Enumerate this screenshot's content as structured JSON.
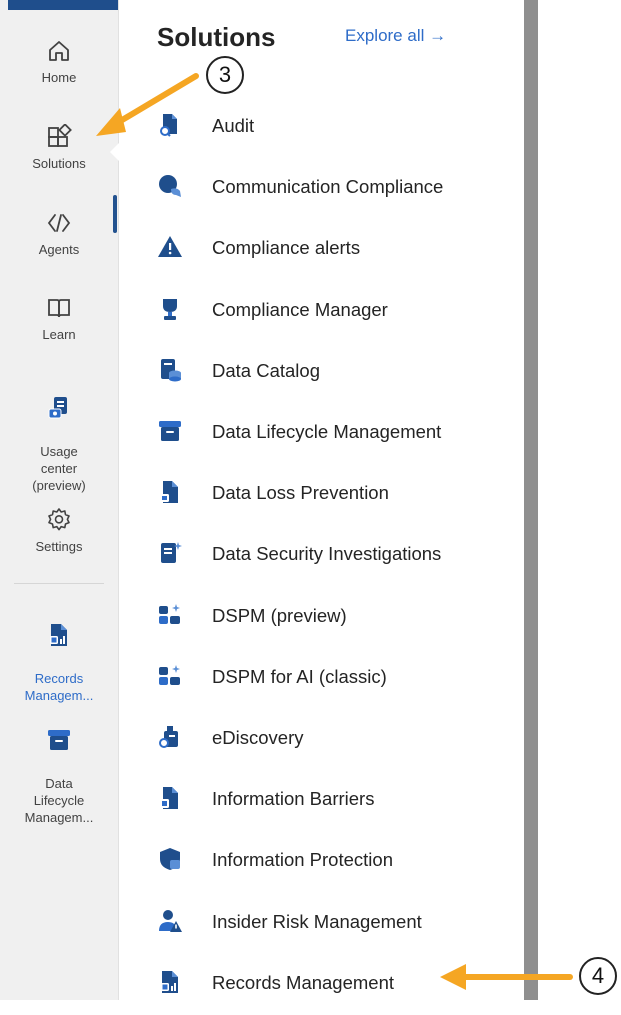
{
  "rail": {
    "items": [
      {
        "label": "Home",
        "icon": "home-icon"
      },
      {
        "label": "Solutions",
        "icon": "solutions-icon"
      },
      {
        "label": "Agents",
        "icon": "agents-icon"
      },
      {
        "label": "Learn",
        "icon": "learn-icon"
      },
      {
        "label": "Usage\ncenter\n(preview)",
        "icon": "usage-center-icon"
      },
      {
        "label": "Settings",
        "icon": "gear-icon"
      },
      {
        "label": "Records\nManagem...",
        "icon": "records-management-icon"
      },
      {
        "label": "Data\nLifecycle\nManagem...",
        "icon": "data-lifecycle-icon"
      }
    ]
  },
  "panel": {
    "title": "Solutions",
    "explore_label": "Explore all →",
    "items": [
      {
        "label": "Audit",
        "icon": "audit-icon"
      },
      {
        "label": "Communication Compliance",
        "icon": "chat-bubble-icon"
      },
      {
        "label": "Compliance alerts",
        "icon": "warning-icon"
      },
      {
        "label": "Compliance Manager",
        "icon": "trophy-icon"
      },
      {
        "label": "Data Catalog",
        "icon": "data-catalog-icon"
      },
      {
        "label": "Data Lifecycle Management",
        "icon": "archive-icon"
      },
      {
        "label": "Data Loss Prevention",
        "icon": "file-lock-icon"
      },
      {
        "label": "Data Security Investigations",
        "icon": "document-sparkle-icon"
      },
      {
        "label": "DSPM (preview)",
        "icon": "dspm-sparkle-icon"
      },
      {
        "label": "DSPM for AI (classic)",
        "icon": "dspm-ai-sparkle-icon"
      },
      {
        "label": "eDiscovery",
        "icon": "ediscovery-icon"
      },
      {
        "label": "Information Barriers",
        "icon": "info-barrier-icon"
      },
      {
        "label": "Information Protection",
        "icon": "shield-lock-icon"
      },
      {
        "label": "Insider Risk Management",
        "icon": "person-warning-icon"
      },
      {
        "label": "Records Management",
        "icon": "records-management-icon"
      }
    ]
  },
  "annotations": {
    "step3": "3",
    "step4": "4",
    "arrow_color": "#f5a623"
  },
  "colors": {
    "accent": "#2e6cc8",
    "icon_blue": "#1f4e8c"
  }
}
